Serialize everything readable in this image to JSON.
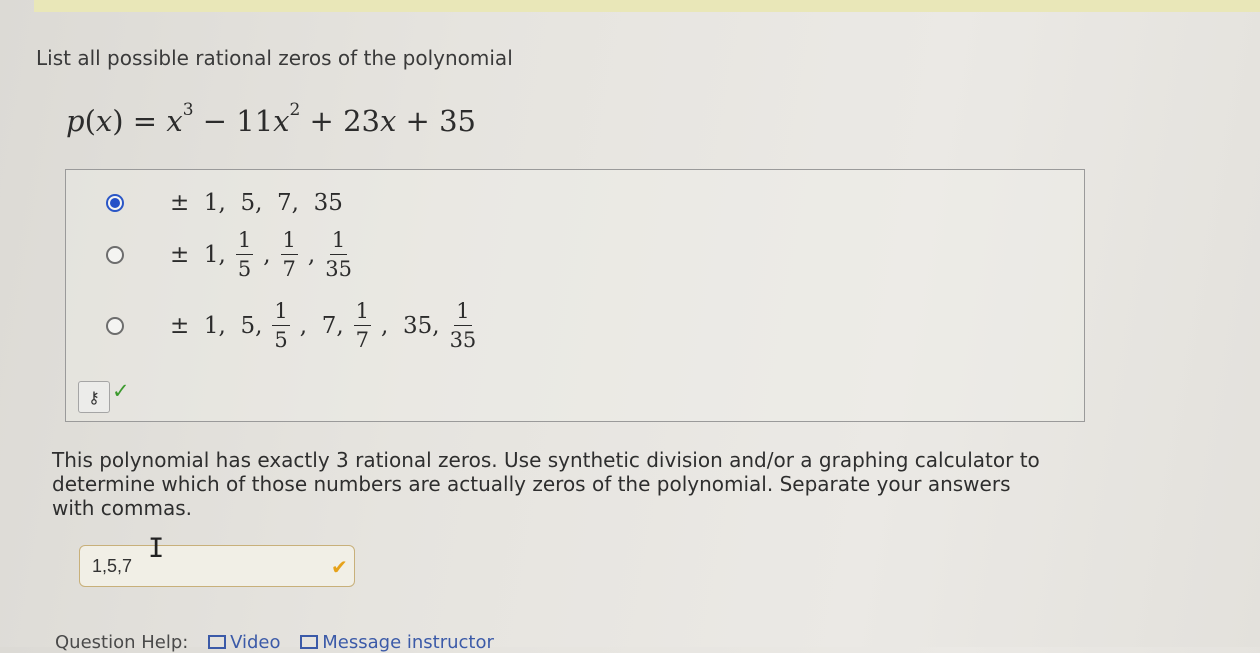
{
  "question": {
    "prompt": "List all possible rational zeros of the polynomial",
    "polynomial": {
      "lhs": "p(x)",
      "rhs": "x³ − 11x² + 23x + 35"
    },
    "options": [
      {
        "text": "± 1, 5, 7, 35",
        "selected": true
      },
      {
        "text": "± 1, 1/5, 1/7, 1/35",
        "selected": false
      },
      {
        "text": "± 1, 5, 1/5, 7, 1/7, 35, 1/35",
        "selected": false
      }
    ],
    "key_icon": "key-icon",
    "status": "correct"
  },
  "part2": {
    "instruction": "This polynomial has exactly 3 rational zeros. Use synthetic division and/or a graphing calculator to determine which of those numbers are actually zeros of the polynomial. Separate your answers with commas.",
    "answer_value": "1,5,7",
    "answer_status": "correct"
  },
  "help": {
    "label": "Question Help:",
    "video": "Video",
    "message": "Message instructor"
  },
  "colors": {
    "selected_radio": "#2450c8",
    "correct": "#3c9a2e",
    "answer_check": "#e6a21a"
  }
}
